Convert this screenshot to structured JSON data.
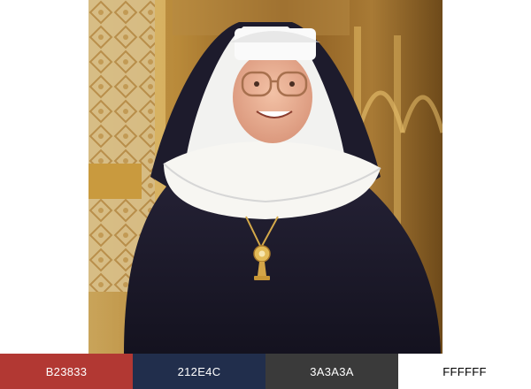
{
  "photo": {
    "subject": "portrait"
  },
  "palette": {
    "swatches": [
      {
        "hex_label": "B23833",
        "color": "#B23833",
        "text_color": "#ffffff"
      },
      {
        "hex_label": "212E4C",
        "color": "#212E4C",
        "text_color": "#ffffff"
      },
      {
        "hex_label": "3A3A3A",
        "color": "#3A3A3A",
        "text_color": "#ffffff"
      },
      {
        "hex_label": "FFFFFF",
        "color": "#FFFFFF",
        "text_color": "#000000"
      }
    ]
  }
}
